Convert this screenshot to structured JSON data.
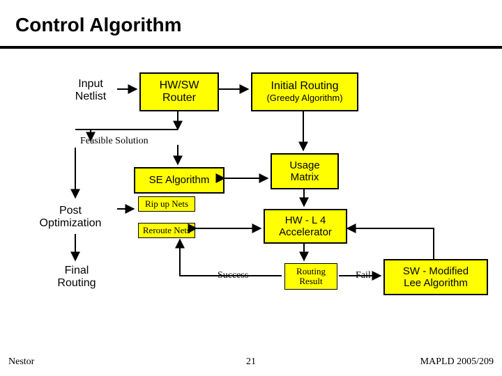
{
  "title": "Control Algorithm",
  "labels": {
    "input_netlist": "Input\nNetlist",
    "feasible": "Feasible Solution",
    "post_opt": "Post\nOptimization",
    "final": "Final\nRouting",
    "success": "Success",
    "fail": "Fail"
  },
  "boxes": {
    "hwsw": "HW/SW\nRouter",
    "initial_routing": "Initial Routing",
    "initial_sub": "(Greedy Algorithm)",
    "se_alg": "SE Algorithm",
    "usage": "Usage\nMatrix",
    "ripup": "Rip up Nets",
    "reroute": "Reroute Nets",
    "hw_accel": "HW - L 4\nAccelerator",
    "routing_result": "Routing\nResult",
    "sw_lee": "SW - Modified\nLee Algorithm"
  },
  "footer": {
    "left": "Nestor",
    "page": "21",
    "right": "MAPLD 2005/209"
  }
}
